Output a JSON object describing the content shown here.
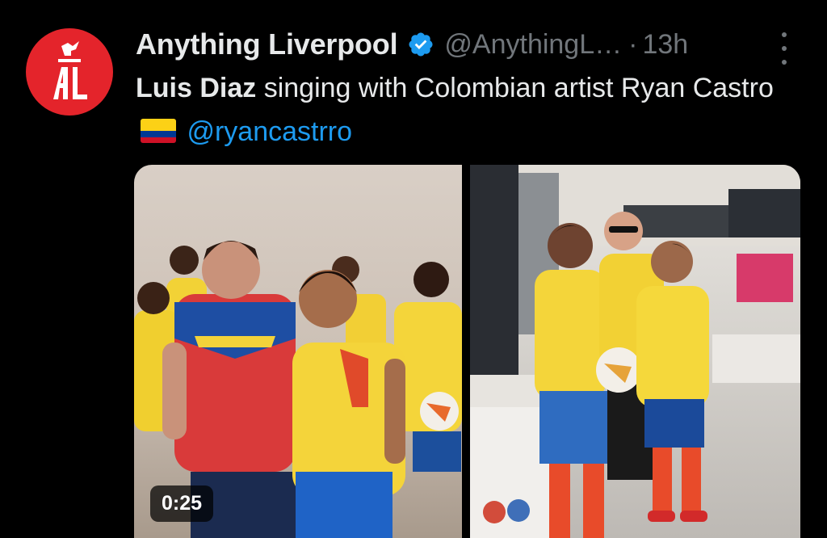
{
  "tweet": {
    "author": {
      "display_name": "Anything Liverpool",
      "handle": "@AnythingL…",
      "verified_icon": "verified-badge-icon",
      "avatar_text": "AL",
      "avatar_color": "#e4242b"
    },
    "separator": "·",
    "timestamp": "13h",
    "more_icon": "more-vertical-icon",
    "text": {
      "bold_part": "Luis Diaz",
      "line_rest": " singing with Colombian artist Ryan Castro ",
      "flag_emoji": "colombia-flag-icon",
      "mention": "@ryancastrro"
    },
    "media": {
      "video": {
        "duration": "0:25"
      },
      "photo": {}
    }
  },
  "colors": {
    "background": "#000000",
    "primary_text": "#e7e9ea",
    "secondary_text": "#71767b",
    "link": "#1d9bf0",
    "verified": "#1d9bf0"
  }
}
